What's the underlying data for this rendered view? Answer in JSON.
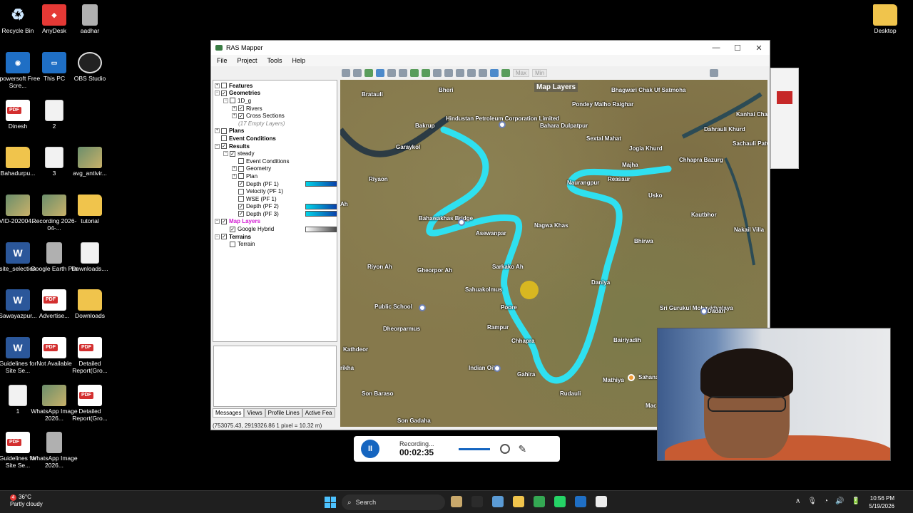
{
  "desktop": {
    "icons": [
      {
        "label": "Recycle Bin",
        "type": "recycle",
        "glyph": "♻"
      },
      {
        "label": "AnyDesk",
        "type": "red",
        "glyph": "◆"
      },
      {
        "label": "aadhar",
        "type": "grey",
        "glyph": ""
      },
      {
        "label": "Desktop",
        "type": "folder",
        "glyph": ""
      },
      {
        "label": "Apowersoft Free Scre...",
        "type": "app",
        "glyph": "◉"
      },
      {
        "label": "This PC",
        "type": "app",
        "glyph": "▭"
      },
      {
        "label": "OBS Studio",
        "type": "obs",
        "glyph": ""
      },
      {
        "label": "Dinesh",
        "type": "pdf",
        "glyph": ""
      },
      {
        "label": "2",
        "type": "doc",
        "glyph": ""
      },
      {
        "label": "Bahadurpu...",
        "type": "folder",
        "glyph": ""
      },
      {
        "label": "3",
        "type": "doc",
        "glyph": ""
      },
      {
        "label": "avg_antivir...",
        "type": "img",
        "glyph": ""
      },
      {
        "label": "VID-202004...",
        "type": "img",
        "glyph": ""
      },
      {
        "label": "Recording 2026-04-...",
        "type": "img",
        "glyph": ""
      },
      {
        "label": "tutorial",
        "type": "folder",
        "glyph": ""
      },
      {
        "label": "site_selection",
        "type": "word",
        "glyph": "W"
      },
      {
        "label": "Google Earth Pro",
        "type": "grey",
        "glyph": ""
      },
      {
        "label": "Downloads....",
        "type": "doc",
        "glyph": ""
      },
      {
        "label": "Sawayazpur...",
        "type": "word",
        "glyph": "W"
      },
      {
        "label": "Advertise...",
        "type": "pdf",
        "glyph": ""
      },
      {
        "label": "Downloads",
        "type": "folder",
        "glyph": ""
      },
      {
        "label": "Guidelines for Site Se...",
        "type": "word",
        "glyph": "W"
      },
      {
        "label": "Not Available",
        "type": "pdf",
        "glyph": ""
      },
      {
        "label": "Detailed Report(Gro...",
        "type": "pdf",
        "glyph": ""
      },
      {
        "label": "1",
        "type": "doc",
        "glyph": ""
      },
      {
        "label": "WhatsApp Image 2026...",
        "type": "img",
        "glyph": ""
      },
      {
        "label": "Detailed Report(Gro...",
        "type": "pdf",
        "glyph": ""
      },
      {
        "label": "Guidelines for Site Se...",
        "type": "pdf",
        "glyph": ""
      },
      {
        "label": "WhatsApp Image 2026...",
        "type": "grey",
        "glyph": ""
      }
    ]
  },
  "window": {
    "title": "RAS Mapper",
    "controls": {
      "minimize": "—",
      "maximize": "☐",
      "close": "✕"
    },
    "menu": [
      "File",
      "Project",
      "Tools",
      "Help"
    ],
    "toolbar": {
      "max_label": "Max",
      "min_label": "Min"
    },
    "tree": [
      {
        "label": "Features",
        "level": 0,
        "exp": "+",
        "checked": false,
        "style": "bold"
      },
      {
        "label": "Geometries",
        "level": 0,
        "exp": "−",
        "checked": true,
        "style": "bold"
      },
      {
        "label": "1D_g",
        "level": 1,
        "exp": "−",
        "checked": false,
        "style": ""
      },
      {
        "label": "Rivers",
        "level": 2,
        "exp": "+",
        "checked": true,
        "style": ""
      },
      {
        "label": "Cross Sections",
        "level": 2,
        "exp": "+",
        "checked": true,
        "style": ""
      },
      {
        "label": "(17 Empty Layers)",
        "level": 2,
        "exp": "",
        "checked": null,
        "style": "italic"
      },
      {
        "label": "Plans",
        "level": 0,
        "exp": "+",
        "checked": false,
        "style": "bold"
      },
      {
        "label": "Event Conditions",
        "level": 0,
        "exp": "",
        "checked": false,
        "style": "bold"
      },
      {
        "label": "Results",
        "level": 0,
        "exp": "−",
        "checked": true,
        "style": "bold"
      },
      {
        "label": "steady",
        "level": 1,
        "exp": "−",
        "checked": true,
        "style": ""
      },
      {
        "label": "Event Conditions",
        "level": 2,
        "exp": "",
        "checked": false,
        "style": ""
      },
      {
        "label": "Geometry",
        "level": 2,
        "exp": "+",
        "checked": false,
        "style": ""
      },
      {
        "label": "Plan",
        "level": 2,
        "exp": "+",
        "checked": false,
        "style": ""
      },
      {
        "label": "Depth (PF 1)",
        "level": 2,
        "exp": "",
        "checked": true,
        "style": "",
        "legend": "blue"
      },
      {
        "label": "Velocity (PF 1)",
        "level": 2,
        "exp": "",
        "checked": false,
        "style": ""
      },
      {
        "label": "WSE (PF 1)",
        "level": 2,
        "exp": "",
        "checked": false,
        "style": ""
      },
      {
        "label": "Depth (PF 2)",
        "level": 2,
        "exp": "",
        "checked": true,
        "style": "",
        "legend": "blue"
      },
      {
        "label": "Depth (PF 3)",
        "level": 2,
        "exp": "",
        "checked": true,
        "style": "",
        "legend": "blue"
      },
      {
        "label": "Map Layers",
        "level": 0,
        "exp": "−",
        "checked": true,
        "style": "magenta"
      },
      {
        "label": "Google Hybrid",
        "level": 1,
        "exp": "",
        "checked": true,
        "style": "",
        "legend": "grey"
      },
      {
        "label": "Terrains",
        "level": 0,
        "exp": "−",
        "checked": true,
        "style": "bold"
      },
      {
        "label": "Terrain",
        "level": 1,
        "exp": "",
        "checked": false,
        "style": ""
      }
    ],
    "tabs": [
      "Messages",
      "Views",
      "Profile Lines",
      "Active Fea"
    ],
    "status_text": "(753075.43, 2919326.86  1 pixel = 10.32 m)"
  },
  "map": {
    "overlay_title": "Map Layers",
    "river_color": "#2fe0f0",
    "places": [
      {
        "name": "Bhagwari Chak Uf Satmoha",
        "cls": ""
      },
      {
        "name": "Kanhai Cha...",
        "cls": ""
      },
      {
        "name": "Bratauli",
        "cls": ""
      },
      {
        "name": "Bheri",
        "cls": ""
      },
      {
        "name": "Hindustan Petroleum Corporation Limited",
        "cls": ""
      },
      {
        "name": "Pondey Malho Raighar",
        "cls": ""
      },
      {
        "name": "Dahrauli Khurd",
        "cls": ""
      },
      {
        "name": "Bahara Dulpatpur",
        "cls": ""
      },
      {
        "name": "Sachauli Patwariya",
        "cls": ""
      },
      {
        "name": "Bakrup",
        "cls": ""
      },
      {
        "name": "Sextal Mahat",
        "cls": ""
      },
      {
        "name": "Jogia Khurd",
        "cls": ""
      },
      {
        "name": "Garaykol",
        "cls": ""
      },
      {
        "name": "Chhapra Bazurg",
        "cls": ""
      },
      {
        "name": "Majha",
        "cls": ""
      },
      {
        "name": "Riyaon",
        "cls": ""
      },
      {
        "name": "Naurangpur",
        "cls": ""
      },
      {
        "name": "Reasaur",
        "cls": ""
      },
      {
        "name": "Usko",
        "cls": ""
      },
      {
        "name": "Ah",
        "cls": ""
      },
      {
        "name": "Kautbhor",
        "cls": ""
      },
      {
        "name": "Bahawakhas Bridge",
        "cls": ""
      },
      {
        "name": "Nagwa Khas",
        "cls": ""
      },
      {
        "name": "Asewanpar",
        "cls": ""
      },
      {
        "name": "Nakail Villa",
        "cls": ""
      },
      {
        "name": "Bhirwa",
        "cls": ""
      },
      {
        "name": "Riyon Ah",
        "cls": ""
      },
      {
        "name": "Gheorpor Ah",
        "cls": ""
      },
      {
        "name": "Sarkako Ah",
        "cls": ""
      },
      {
        "name": "Sahuakolmus",
        "cls": ""
      },
      {
        "name": "Daniya",
        "cls": ""
      },
      {
        "name": "Public School",
        "cls": ""
      },
      {
        "name": "Poore",
        "cls": ""
      },
      {
        "name": "Sri Gurukul Mohavidyalaya",
        "cls": ""
      },
      {
        "name": "Dadari",
        "cls": ""
      },
      {
        "name": "Dheorparmus",
        "cls": ""
      },
      {
        "name": "Rampur",
        "cls": ""
      },
      {
        "name": "Chhapra",
        "cls": ""
      },
      {
        "name": "Bairiyadih",
        "cls": ""
      },
      {
        "name": "Kathdeor",
        "cls": ""
      },
      {
        "name": "Indian Oil",
        "cls": ""
      },
      {
        "name": "Gahira",
        "cls": ""
      },
      {
        "name": "Mathiya",
        "cls": ""
      },
      {
        "name": "Sahana",
        "cls": ""
      },
      {
        "name": "Son Baraso",
        "cls": ""
      },
      {
        "name": "Rudauli",
        "cls": ""
      },
      {
        "name": "Son Gadaha",
        "cls": ""
      },
      {
        "name": "Mac",
        "cls": ""
      },
      {
        "name": "rikha",
        "cls": ""
      }
    ]
  },
  "recorder": {
    "status": "Recording...",
    "time": "00:02:35",
    "pause_glyph": "II",
    "pen_glyph": "✎"
  },
  "taskbar": {
    "weather_temp": "36°C",
    "weather_desc": "Partly cloudy",
    "weather_badge": "4",
    "search_placeholder": "Search",
    "search_icon": "⌕",
    "time": "10:56 PM",
    "date": "5/19/2026",
    "tray_glyphs": [
      "∧",
      "🎙",
      "◔",
      "🔊",
      "🔋"
    ],
    "apps": [
      "#c8a86b",
      "#2b2b2b",
      "#5b9bd5",
      "#f0c44c",
      "#34a853",
      "#25d366",
      "#1f6fc5",
      "#ececec"
    ]
  }
}
